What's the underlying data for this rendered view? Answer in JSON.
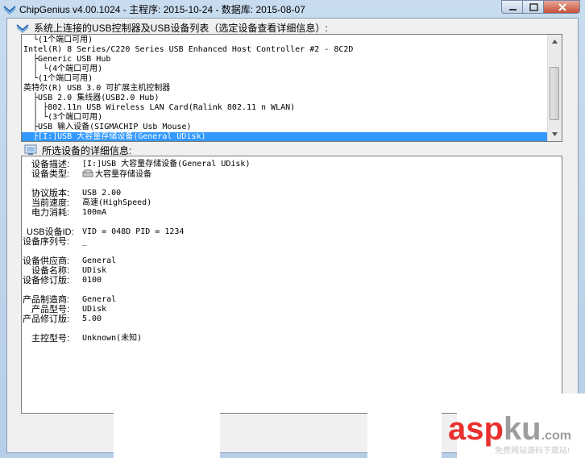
{
  "window": {
    "title": "ChipGenius v4.00.1024 - 主程序: 2015-10-24 - 数据库: 2015-08-07"
  },
  "device_list": {
    "header": "系统上连接的USB控制器及USB设备列表（选定设备查看详细信息）:",
    "rows": [
      {
        "text": "  └(1个端口可用)",
        "selected": false
      },
      {
        "text": "Intel(R) 8 Series/C220 Series USB Enhanced Host Controller #2 - 8C2D",
        "selected": false
      },
      {
        "text": "  ├Generic USB Hub",
        "selected": false
      },
      {
        "text": "  │ └(4个端口可用)",
        "selected": false
      },
      {
        "text": "  └(1个端口可用)",
        "selected": false
      },
      {
        "text": "英特尔(R) USB 3.0 可扩展主机控制器",
        "selected": false
      },
      {
        "text": "  ├USB 2.0 集线器(USB2.0 Hub)",
        "selected": false
      },
      {
        "text": "  │ ├802.11n USB Wireless LAN Card(Ralink 802.11 n WLAN)",
        "selected": false
      },
      {
        "text": "  │ └(3个端口可用)",
        "selected": false
      },
      {
        "text": "  ├USB 输入设备(SIGMACHIP Usb Mouse)",
        "selected": false
      },
      {
        "text": "  ├[I:]USB 大容量存储设备(General UDisk)",
        "selected": true
      }
    ]
  },
  "details": {
    "header": "所选设备的详细信息:",
    "fields": [
      {
        "label": "设备描述:",
        "value": "[I:]USB 大容量存储设备(General UDisk)",
        "icon": false
      },
      {
        "label": "设备类型:",
        "value": "大容量存储设备",
        "icon": true
      },
      {
        "label": "协议版本:",
        "value": "USB 2.00",
        "icon": false
      },
      {
        "label": "当前速度:",
        "value": "高速(HighSpeed)",
        "icon": false
      },
      {
        "label": "电力消耗:",
        "value": "100mA",
        "icon": false
      },
      {
        "label": "USB设备ID:",
        "value": "VID = 048D PID = 1234",
        "icon": false
      },
      {
        "label": "设备序列号:",
        "value": "_",
        "icon": false
      },
      {
        "label": "设备供应商:",
        "value": "General",
        "icon": false
      },
      {
        "label": "设备名称:",
        "value": "UDisk",
        "icon": false
      },
      {
        "label": "设备修订版:",
        "value": "0100",
        "icon": false
      },
      {
        "label": "产品制造商:",
        "value": "General",
        "icon": false
      },
      {
        "label": "产品型号:",
        "value": "UDisk",
        "icon": false
      },
      {
        "label": "产品修订版:",
        "value": "5.00",
        "icon": false
      },
      {
        "label": "主控型号:",
        "value": "Unknown(未知)",
        "icon": false
      }
    ]
  },
  "watermark": {
    "brand_red": "asp",
    "brand_gray": "ku",
    "brand_suffix": ".com",
    "subtitle": "免费网站源码下载站!"
  },
  "colors": {
    "selection": "#3399ff",
    "watermark_red": "#e8312e"
  }
}
